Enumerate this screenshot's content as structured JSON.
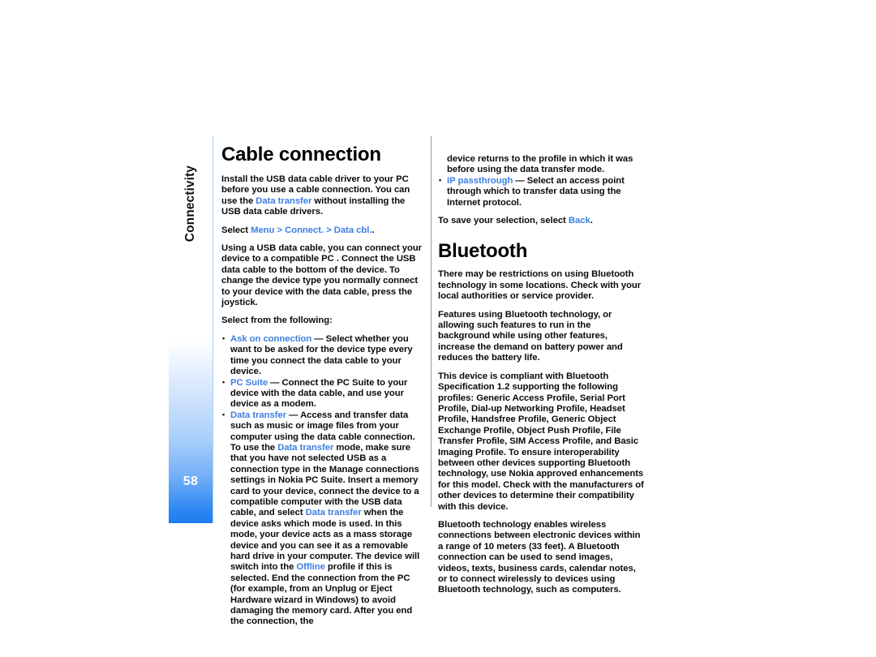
{
  "sidebar": {
    "tab_label": "Connectivity",
    "page_number": "58",
    "accent_color": "#2b86f0",
    "rule_color": "#a9cff0"
  },
  "link_color": "#3d7fe3",
  "left_column": {
    "heading": "Cable connection",
    "paragraph_1_a": "Install the USB data cable driver to your PC before you use a cable connection. You can use the ",
    "paragraph_1_link": "Data transfer",
    "paragraph_1_b": " without installing the USB data cable drivers.",
    "select_prefix": "Select ",
    "select_menu": "Menu",
    "select_gt1": " > ",
    "select_connect": "Connect.",
    "select_gt2": " > ",
    "select_datacbl": "Data cbl.",
    "select_suffix": ".",
    "paragraph_2": "Using a USB data cable, you can connect your device to a compatible PC . Connect the USB data cable to the bottom of the device. To change the device type you normally connect to your device with the data cable, press the joystick.",
    "paragraph_3": "Select from the following:",
    "bullets": [
      {
        "term": "Ask on connection",
        "dash": " — ",
        "text": "Select whether you want to be asked for the device type every time you connect the data cable to your device."
      },
      {
        "term": "PC Suite",
        "dash": " — ",
        "text": "Connect the PC Suite to your device with the data cable, and use your device as a modem."
      }
    ],
    "data_transfer_bullet": {
      "term": "Data transfer",
      "dash": " — ",
      "text_1": "Access and transfer data such as music or image files from your computer using the data cable connection. To use the ",
      "link_1": "Data transfer",
      "text_2": " mode, make sure that you have not selected USB as a connection type in the Manage connections settings in Nokia PC Suite. Insert a memory card to your device, connect the device to a compatible computer with the USB data cable, and select ",
      "link_2": "Data transfer",
      "text_3": " when the device asks which mode is used. In this mode, your device acts as a mass storage device and you can see it as a removable hard drive in your computer. The device will switch into the ",
      "link_3": "Offline",
      "text_4": " profile if this is selected. End the connection from the PC (for example, from an Unplug or Eject Hardware wizard in Windows) to avoid damaging the memory card. After you end the connection, the"
    }
  },
  "right_column": {
    "continuation": "device returns to the profile in which it was before using the data transfer mode.",
    "bullet_ip": {
      "term": "IP passthrough",
      "dash": " — ",
      "text": "Select an access point through which to transfer data using the Internet protocol."
    },
    "save_prefix": "To save your selection, select ",
    "save_link": "Back",
    "save_suffix": ".",
    "heading": "Bluetooth",
    "paragraph_1": "There may be restrictions on using Bluetooth technology in some locations. Check with your local authorities or service provider.",
    "paragraph_2": "Features using Bluetooth technology, or allowing such features to run in the background while using other features, increase the demand on battery power and reduces the battery life.",
    "paragraph_3": "This device is compliant with Bluetooth Specification 1.2 supporting the following profiles: Generic Access Profile, Serial Port Profile, Dial-up Networking Profile, Headset Profile, Handsfree Profile, Generic Object Exchange Profile, Object Push Profile, File Transfer Profile, SIM Access Profile, and Basic Imaging Profile. To ensure interoperability between other devices supporting Bluetooth technology, use Nokia approved enhancements for this model. Check with the manufacturers of other devices to determine their compatibility with this device.",
    "paragraph_4": "Bluetooth technology enables wireless connections between electronic devices within a range of 10 meters (33 feet). A Bluetooth connection can be used to send images, videos, texts, business cards, calendar notes, or to connect wirelessly to devices using Bluetooth technology, such as computers."
  }
}
